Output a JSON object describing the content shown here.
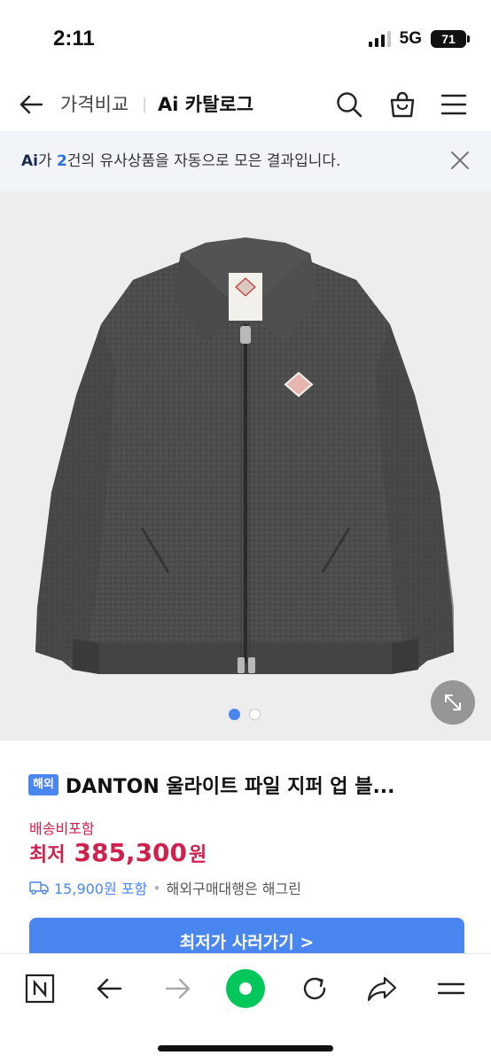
{
  "status_bar": {
    "time": "2:11",
    "network": "5G",
    "battery": "71"
  },
  "header": {
    "back_icon": "arrow-left-icon",
    "breadcrumb": "가격비교",
    "title": "Ai 카탈로그",
    "icons": [
      "search-icon",
      "shopping-bag-icon",
      "menu-icon"
    ]
  },
  "banner": {
    "ai_prefix": "Ai",
    "text_before_count": "가 ",
    "count": "2",
    "text_after_count": "건의 유사상품을 자동으로 모은 결과입니다.",
    "close_icon": "close-icon"
  },
  "product": {
    "image_subject": "charcoal wool zip-up blouson jacket",
    "carousel": {
      "current": 1,
      "total": 2
    },
    "expand_icon": "expand-icon",
    "badge": "해외",
    "name": "DANTON 울라이트 파일 지퍼 업 블...",
    "shipping_note": "배송비포함",
    "price_label": "최저",
    "price_value": "385,300",
    "price_unit": "원",
    "delivery_fee": "15,900원 포함",
    "delivery_bullet": "•",
    "delivery_note": "해외구매대행은 해그린",
    "buy_button": "최저가 사러가기 >"
  },
  "toolbar": {
    "buttons": [
      "naver-n-icon",
      "back-arrow-icon",
      "forward-arrow-icon",
      "home-green-icon",
      "refresh-icon",
      "share-icon",
      "menu-icon"
    ]
  },
  "colors": {
    "accent_blue": "#4a86f0",
    "price_red": "#d0214d",
    "banner_bg": "#f1f4f9",
    "naver_green": "#03c75a"
  }
}
